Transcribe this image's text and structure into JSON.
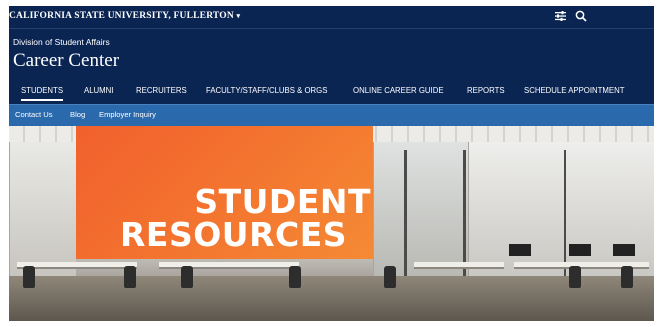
{
  "header": {
    "university": "CALIFORNIA STATE UNIVERSITY, FULLERTON",
    "university_caret": "▾",
    "filter_icon": "sliders-icon",
    "search_icon": "search-icon"
  },
  "site": {
    "division": "Division of Student Affairs",
    "title": "Career Center"
  },
  "nav": {
    "items": [
      {
        "label": "STUDENTS",
        "active": true
      },
      {
        "label": "ALUMNI",
        "active": false
      },
      {
        "label": "RECRUITERS",
        "active": false
      },
      {
        "label": "FACULTY/STAFF/CLUBS & ORGS",
        "active": false
      },
      {
        "label": "ONLINE CAREER GUIDE",
        "active": false
      },
      {
        "label": "REPORTS",
        "active": false
      },
      {
        "label": "SCHEDULE APPOINTMENT",
        "active": false
      }
    ]
  },
  "subnav": {
    "items": [
      {
        "label": "Contact Us"
      },
      {
        "label": "Blog"
      },
      {
        "label": "Employer Inquiry"
      }
    ]
  },
  "hero": {
    "line1": "STUDENT",
    "line2": "RESOURCES",
    "accent": "#f26a2e"
  },
  "colors": {
    "brand_navy": "#0b2553",
    "subnav_blue": "#2b69ad",
    "white": "#ffffff"
  }
}
